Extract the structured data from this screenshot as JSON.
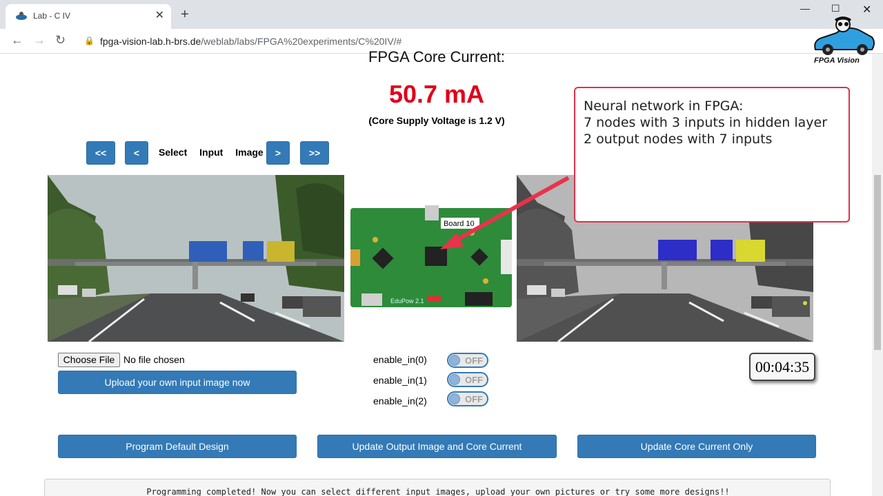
{
  "browser": {
    "tab_title": "Lab - C IV",
    "new_tab": "+",
    "url_host": "fpga-vision-lab.h-brs.de",
    "url_path": "/weblab/labs/FPGA%20experiments/C%20IV/#"
  },
  "logo": {
    "text": "FPGA Vision"
  },
  "core": {
    "title": "FPGA Core Current:",
    "value": "50.7 mA",
    "voltage_note": "(Core Supply Voltage is 1.2 V)"
  },
  "image_nav": {
    "first": "<<",
    "prev": "<",
    "label": "Select Input Image",
    "next": ">",
    "last": ">>"
  },
  "board": {
    "label": "Board 10",
    "silk": "EduPow 2.1"
  },
  "callout": {
    "lines": [
      "Neural network in FPGA:",
      "7 nodes with 3 inputs in hidden layer",
      "2 output nodes with 7 inputs"
    ]
  },
  "upload": {
    "choose_file": "Choose File",
    "no_file": "No file chosen",
    "upload_button": "Upload your own input image now"
  },
  "enables": [
    {
      "label": "enable_in(0)",
      "state": "OFF"
    },
    {
      "label": "enable_in(1)",
      "state": "OFF"
    },
    {
      "label": "enable_in(2)",
      "state": "OFF"
    }
  ],
  "timer": "00:04:35",
  "actions": {
    "program": "Program Default Design",
    "update_both": "Update Output Image and Core Current",
    "update_core": "Update Core Current Only"
  },
  "status": "Programming completed! Now you can select different input images, upload your own pictures or try some more designs!!",
  "colors": {
    "button_blue": "#337ab7",
    "current_red": "#e0001b",
    "callout_border": "#e03048",
    "output_highlight_blue": "#2d2dc8",
    "output_highlight_yellow": "#d8d830"
  }
}
